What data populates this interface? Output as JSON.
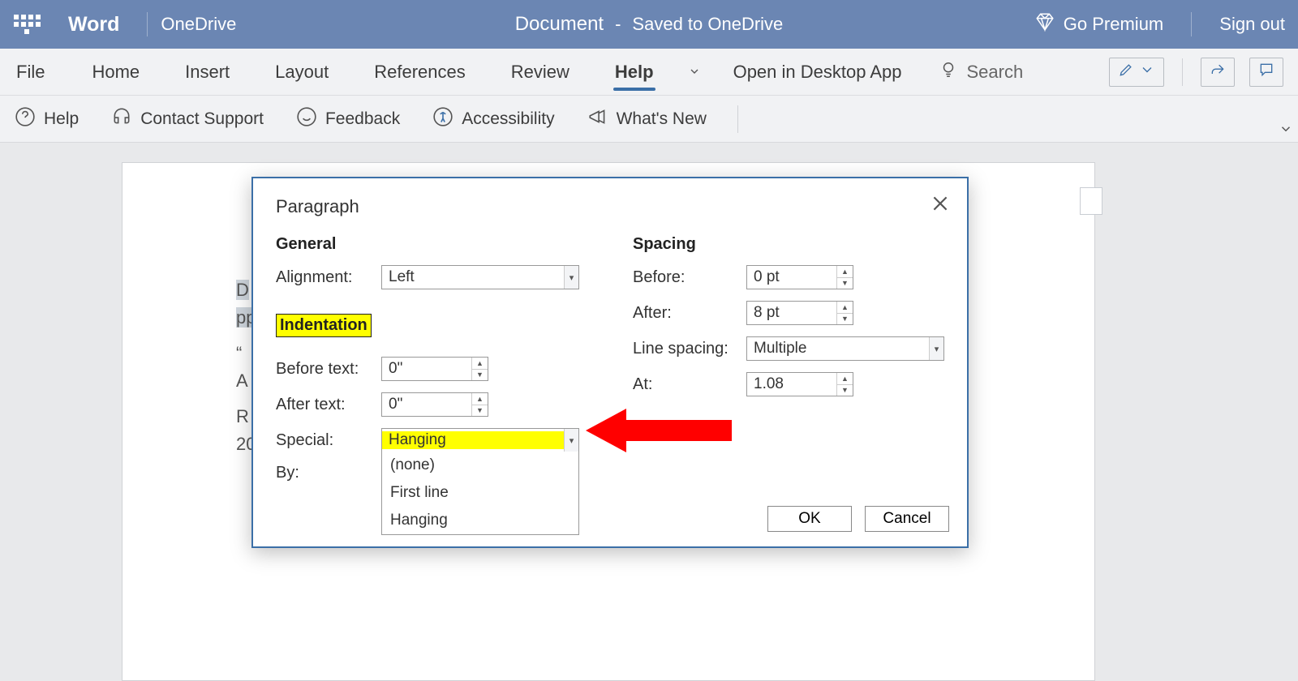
{
  "title_bar": {
    "app": "Word",
    "location": "OneDrive",
    "doc_name": "Document",
    "dash": "-",
    "saved": "Saved to OneDrive",
    "premium": "Go Premium",
    "signout": "Sign out"
  },
  "ribbon_tabs": {
    "file": "File",
    "home": "Home",
    "insert": "Insert",
    "layout": "Layout",
    "references": "References",
    "review": "Review",
    "help": "Help",
    "open_desktop": "Open in Desktop App",
    "search": "Search"
  },
  "ribbon_row": {
    "help": "Help",
    "contact": "Contact Support",
    "feedback": "Feedback",
    "accessibility": "Accessibility",
    "whatsnew": "What's New"
  },
  "doc": {
    "l1a": "D",
    "l2a": "pp",
    "l3": "“",
    "l4": "A",
    "l5": "R",
    "l6": "20"
  },
  "dialog": {
    "title": "Paragraph",
    "general": "General",
    "alignment_label": "Alignment:",
    "alignment_value": "Left",
    "indentation": "Indentation",
    "before_text_label": "Before text:",
    "before_text_value": "0\"",
    "after_text_label": "After text:",
    "after_text_value": "0\"",
    "special_label": "Special:",
    "special_value": "Hanging",
    "special_options": {
      "o1": "(none)",
      "o2": "First line",
      "o3": "Hanging"
    },
    "by_label": "By:",
    "spacing": "Spacing",
    "before_label": "Before:",
    "before_value": "0 pt",
    "after_label": "After:",
    "after_value": "8 pt",
    "linespacing_label": "Line spacing:",
    "linespacing_value": "Multiple",
    "at_label": "At:",
    "at_value": "1.08",
    "ok": "OK",
    "cancel": "Cancel"
  }
}
